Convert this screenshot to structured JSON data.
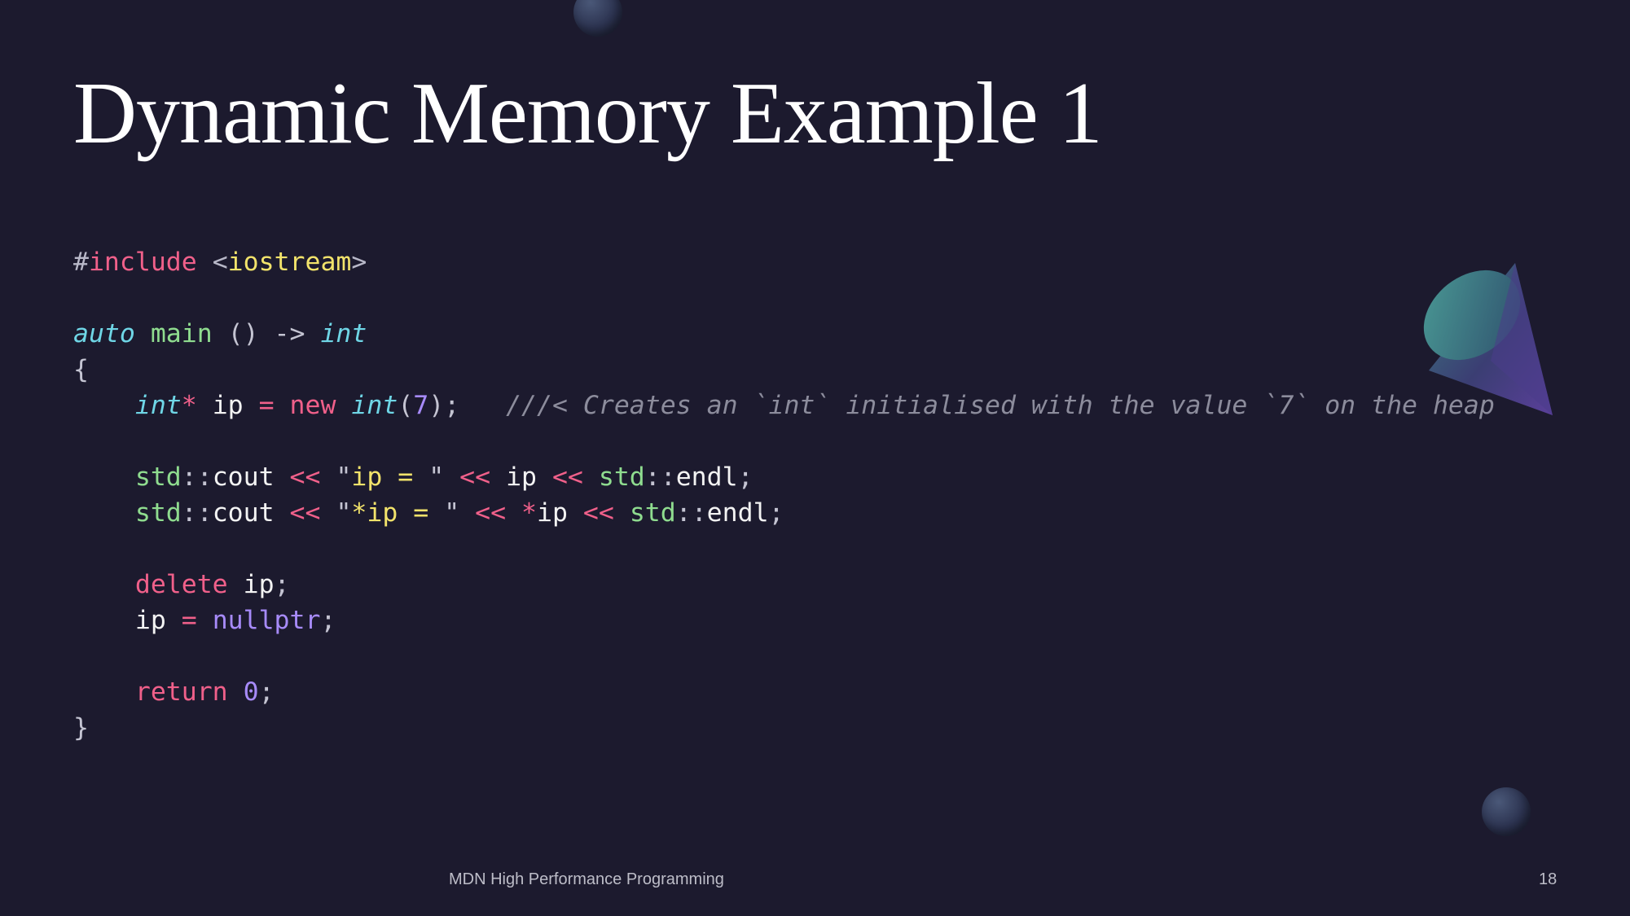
{
  "slide": {
    "title": "Dynamic Memory Example 1",
    "footer": "MDN High Performance Programming",
    "page_number": "18"
  },
  "code": {
    "lines": [
      [
        [
          "pre",
          "#"
        ],
        [
          "kw",
          "include"
        ],
        [
          "pre",
          " <"
        ],
        [
          "str",
          "iostream"
        ],
        [
          "pre",
          ">"
        ]
      ],
      [],
      [
        [
          "type",
          "auto"
        ],
        [
          "id",
          " "
        ],
        [
          "fn",
          "main"
        ],
        [
          "punc",
          " () -> "
        ],
        [
          "type",
          "int"
        ]
      ],
      [
        [
          "punc",
          "{"
        ]
      ],
      [
        [
          "id",
          "    "
        ],
        [
          "type",
          "int"
        ],
        [
          "op",
          "*"
        ],
        [
          "id",
          " ip "
        ],
        [
          "op",
          "="
        ],
        [
          "id",
          " "
        ],
        [
          "kw",
          "new"
        ],
        [
          "id",
          " "
        ],
        [
          "type",
          "int"
        ],
        [
          "punc",
          "("
        ],
        [
          "num",
          "7"
        ],
        [
          "punc",
          ");"
        ],
        [
          "id",
          "   "
        ],
        [
          "cmt",
          "///< Creates an `int` initialised with the value `7` on the heap"
        ]
      ],
      [],
      [
        [
          "id",
          "    "
        ],
        [
          "ns",
          "std"
        ],
        [
          "punc",
          "::"
        ],
        [
          "id",
          "cout "
        ],
        [
          "op",
          "<<"
        ],
        [
          "id",
          " "
        ],
        [
          "punc",
          "\""
        ],
        [
          "str",
          "ip = "
        ],
        [
          "punc",
          "\""
        ],
        [
          "id",
          " "
        ],
        [
          "op",
          "<<"
        ],
        [
          "id",
          " ip "
        ],
        [
          "op",
          "<<"
        ],
        [
          "id",
          " "
        ],
        [
          "ns",
          "std"
        ],
        [
          "punc",
          "::"
        ],
        [
          "id",
          "endl"
        ],
        [
          "punc",
          ";"
        ]
      ],
      [
        [
          "id",
          "    "
        ],
        [
          "ns",
          "std"
        ],
        [
          "punc",
          "::"
        ],
        [
          "id",
          "cout "
        ],
        [
          "op",
          "<<"
        ],
        [
          "id",
          " "
        ],
        [
          "punc",
          "\""
        ],
        [
          "str",
          "*ip = "
        ],
        [
          "punc",
          "\""
        ],
        [
          "id",
          " "
        ],
        [
          "op",
          "<<"
        ],
        [
          "id",
          " "
        ],
        [
          "op",
          "*"
        ],
        [
          "id",
          "ip "
        ],
        [
          "op",
          "<<"
        ],
        [
          "id",
          " "
        ],
        [
          "ns",
          "std"
        ],
        [
          "punc",
          "::"
        ],
        [
          "id",
          "endl"
        ],
        [
          "punc",
          ";"
        ]
      ],
      [],
      [
        [
          "id",
          "    "
        ],
        [
          "kw",
          "delete"
        ],
        [
          "id",
          " ip"
        ],
        [
          "punc",
          ";"
        ]
      ],
      [
        [
          "id",
          "    ip "
        ],
        [
          "op",
          "="
        ],
        [
          "id",
          " "
        ],
        [
          "lit",
          "nullptr"
        ],
        [
          "punc",
          ";"
        ]
      ],
      [],
      [
        [
          "id",
          "    "
        ],
        [
          "kw",
          "return"
        ],
        [
          "id",
          " "
        ],
        [
          "num",
          "0"
        ],
        [
          "punc",
          ";"
        ]
      ],
      [
        [
          "punc",
          "}"
        ]
      ]
    ]
  },
  "colors": {
    "background": "#1c1a2e",
    "keyword": "#f0608a",
    "string": "#f2e36b",
    "type": "#6fd6e6",
    "function": "#8fdc8f",
    "number": "#a78bfa",
    "comment": "#8c8c9c"
  },
  "decorations": [
    "sphere-icon",
    "cone-icon",
    "sphere-icon"
  ]
}
